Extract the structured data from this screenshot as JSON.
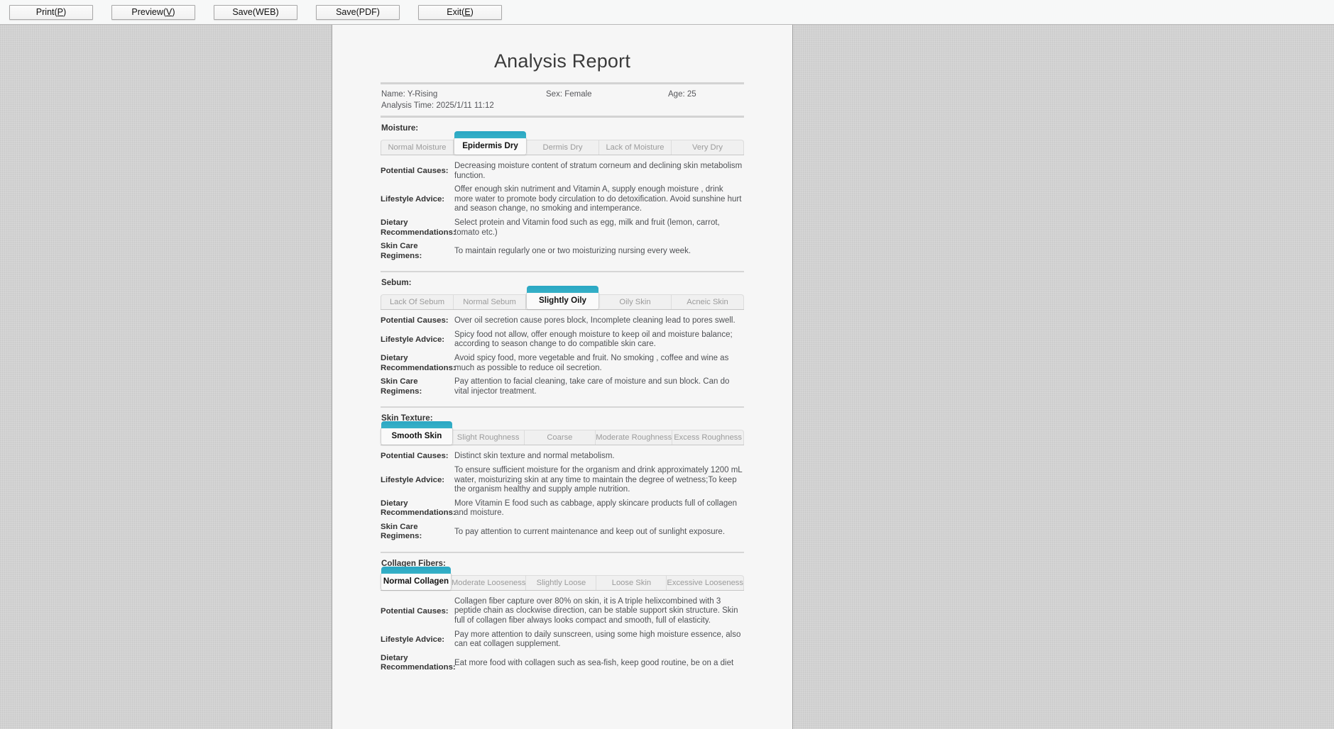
{
  "toolbar": {
    "buttons": [
      {
        "id": "print",
        "label": "Print(P)",
        "accel": "P"
      },
      {
        "id": "preview",
        "label": "Preview(V)",
        "accel": "V"
      },
      {
        "id": "save_web",
        "label": "Save(WEB)",
        "accel": ""
      },
      {
        "id": "save_pdf",
        "label": "Save(PDF)",
        "accel": ""
      },
      {
        "id": "exit",
        "label": "Exit(E)",
        "accel": "E"
      }
    ]
  },
  "report": {
    "title": "Analysis Report",
    "info": {
      "name": "Name: Y-Rising",
      "sex": "Sex: Female",
      "age": "Age: 25",
      "time": "Analysis Time: 2025/1/11 11:12"
    },
    "labels": {
      "potential_causes": "Potential Causes:",
      "lifestyle_advice": "Lifestyle Advice:",
      "dietary_recommendations": "Dietary Recommendations:",
      "skin_care_regimens": "Skin Care Regimens:"
    },
    "sections": [
      {
        "id": "moisture",
        "title": "Moisture:",
        "tabs": [
          "Normal Moisture",
          "Epidermis Dry",
          "Dermis Dry",
          "Lack of Moisture",
          "Very Dry"
        ],
        "active_index": 1,
        "potential_causes": "Decreasing moisture content of stratum corneum and declining skin metabolism function.",
        "lifestyle_advice": "Offer enough skin nutriment and Vitamin A, supply enough moisture , drink more water to promote body circulation to do detoxification. Avoid sunshine hurt and season change, no smoking and intemperance.",
        "dietary_recommendations": "Select protein and Vitamin food such as egg, milk and fruit (lemon, carrot, tomato etc.)",
        "skin_care_regimens": "To maintain regularly one or two moisturizing nursing every week."
      },
      {
        "id": "sebum",
        "title": "Sebum:",
        "tabs": [
          "Lack Of Sebum",
          "Normal Sebum",
          "Slightly Oily",
          "Oily Skin",
          "Acneic Skin"
        ],
        "active_index": 2,
        "potential_causes": "Over oil secretion cause pores block, Incomplete cleaning lead to pores swell.",
        "lifestyle_advice": "Spicy food not allow, offer enough moisture to keep oil and moisture balance; according to season change to do compatible skin care.",
        "dietary_recommendations": "Avoid spicy food, more vegetable and fruit. No smoking , coffee and wine as much as possible to reduce oil secretion.",
        "skin_care_regimens": "Pay attention to facial cleaning, take care of moisture and sun block. Can do vital injector treatment."
      },
      {
        "id": "skin_texture",
        "title": "Skin Texture:",
        "tabs": [
          "Smooth Skin",
          "Slight Roughness",
          "Coarse",
          "Moderate Roughness",
          "Excess Roughness"
        ],
        "active_index": 0,
        "potential_causes": "Distinct skin texture and normal metabolism.",
        "lifestyle_advice": "To ensure sufficient moisture for the organism and drink approximately 1200 mL water, moisturizing skin at any time to maintain the degree of wetness;To keep the organism healthy and supply ample nutrition.",
        "dietary_recommendations": "More Vitamin E food such as cabbage, apply skincare products full of collagen and moisture.",
        "skin_care_regimens": "To pay attention to current maintenance and keep out of sunlight exposure."
      },
      {
        "id": "collagen_fibers",
        "title": "Collagen Fibers:",
        "tabs": [
          "Normal Collagen",
          "Moderate Looseness",
          "Slightly Loose",
          "Loose Skin",
          "Excessive Looseness"
        ],
        "active_index": 0,
        "potential_causes": "Collagen fiber capture over 80% on skin, it is A triple helixcombined with 3 peptide chain as clockwise direction, can be stable support skin structure. Skin full of collagen fiber always looks compact and smooth, full of elasticity.",
        "lifestyle_advice": "Pay more attention to daily sunscreen, using some high moisture essence, also can eat collagen supplement.",
        "dietary_recommendations": "Eat more food with collagen such as sea-fish, keep good routine, be on a diet",
        "skin_care_regimens": ""
      }
    ]
  },
  "colors": {
    "accent": "#2aa7c4",
    "paper": "#f6f6f6",
    "workspace": "#d2d2d2"
  }
}
